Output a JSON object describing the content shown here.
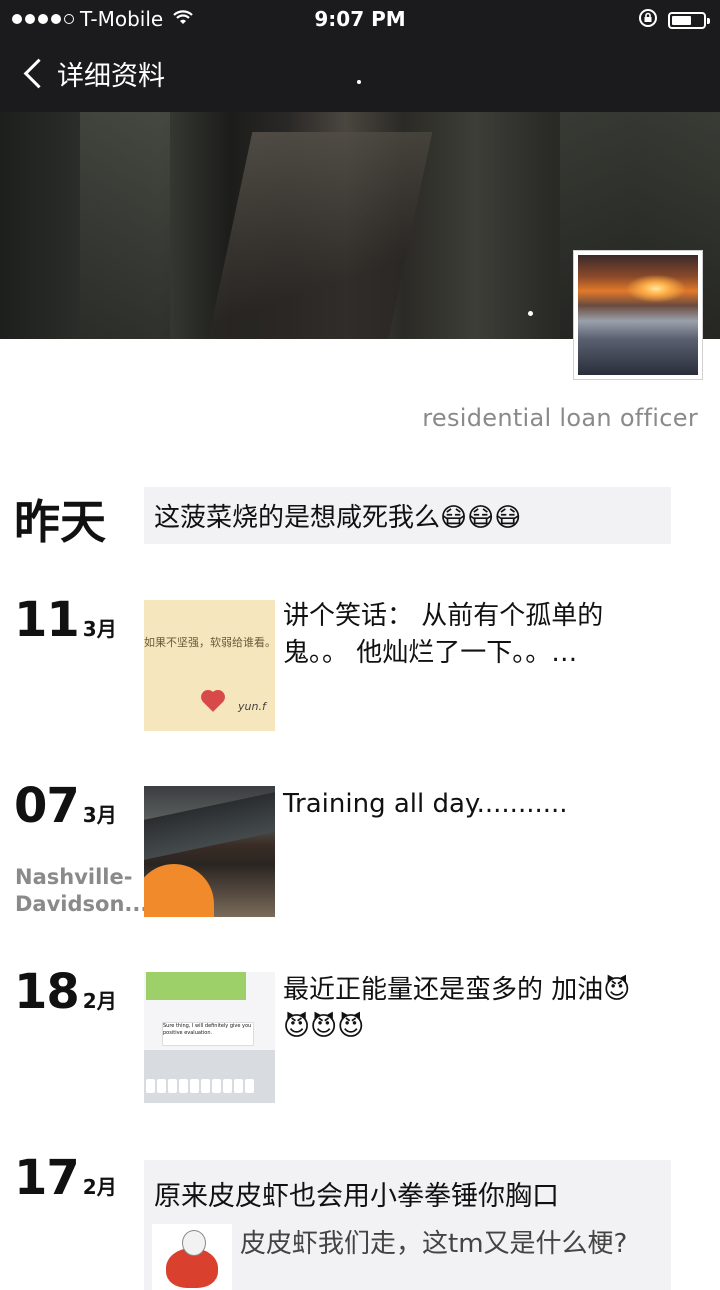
{
  "status_bar": {
    "carrier": "T-Mobile",
    "time": "9:07 PM"
  },
  "nav": {
    "back_label": "详细资料"
  },
  "profile": {
    "tagline": "residential loan officer"
  },
  "timeline": [
    {
      "label": "昨天",
      "text": "这菠菜烧的是想咸死我么😷😷😷"
    },
    {
      "day": "11",
      "month": "3月",
      "text": "讲个笑话： 从前有个孤单的鬼。。 他灿烂了一下。。…",
      "thumb": {
        "quote": "如果不坚强，软弱给谁看。",
        "signature": "yun.f"
      }
    },
    {
      "day": "07",
      "month": "3月",
      "location": "Nashville-Davidson...",
      "text": "Training all day..........."
    },
    {
      "day": "18",
      "month": "2月",
      "text": "最近正能量还是蛮多的 加油😈😈😈😈",
      "thumb": {
        "message": "Sure thing, I will definitely give you positive evaluation."
      }
    },
    {
      "day": "17",
      "month": "2月",
      "text": "原来皮皮虾也会用小拳拳锤你胸口",
      "link_text": "皮皮虾我们走，这tm又是什么梗?"
    }
  ]
}
